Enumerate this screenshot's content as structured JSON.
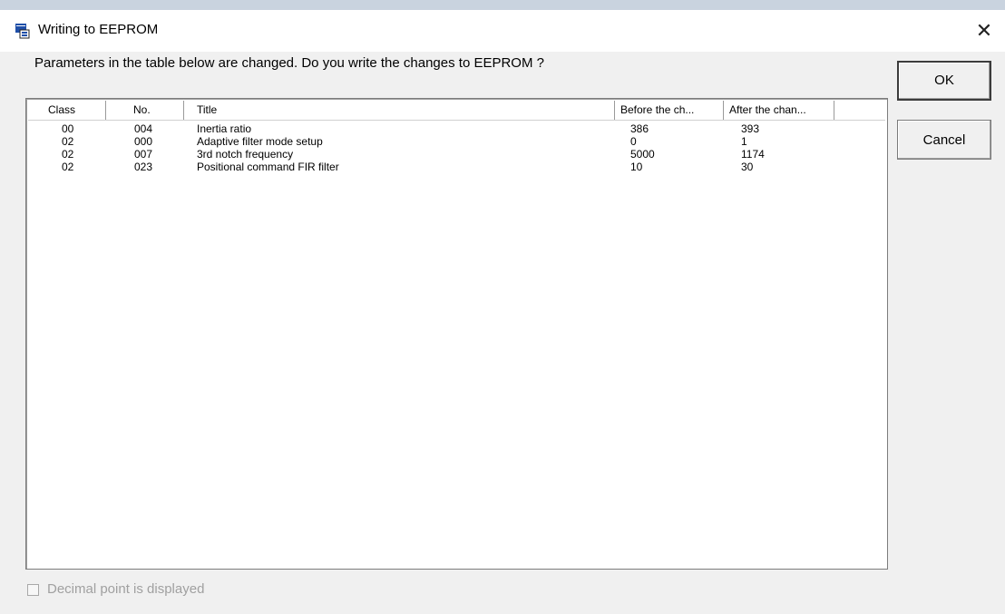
{
  "window": {
    "title": "Writing to EEPROM",
    "close_glyph": "✕"
  },
  "prompt": "Parameters in the table below are changed. Do you write the changes to EEPROM ?",
  "buttons": {
    "ok": "OK",
    "cancel": "Cancel"
  },
  "table": {
    "columns": [
      "Class",
      "No.",
      "Title",
      "Before the ch...",
      "After the chan..."
    ],
    "rows": [
      [
        "00",
        "004",
        "Inertia ratio",
        "386",
        "393"
      ],
      [
        "02",
        "000",
        "Adaptive filter mode setup",
        "0",
        "1"
      ],
      [
        "02",
        "007",
        "3rd notch frequency",
        "5000",
        "1174"
      ],
      [
        "02",
        "023",
        "Positional command FIR filter",
        "10",
        "30"
      ]
    ]
  },
  "checkbox": {
    "label": "Decimal point is displayed",
    "checked": false,
    "enabled": false
  },
  "colors": {
    "dialog_bg": "#f0f0f0",
    "titlebar_bg": "#ffffff",
    "disabled_text": "#a0a0a0",
    "icon_blue": "#1f4fa8"
  },
  "icons": {
    "app": "app-window-icon",
    "close": "close-icon"
  }
}
